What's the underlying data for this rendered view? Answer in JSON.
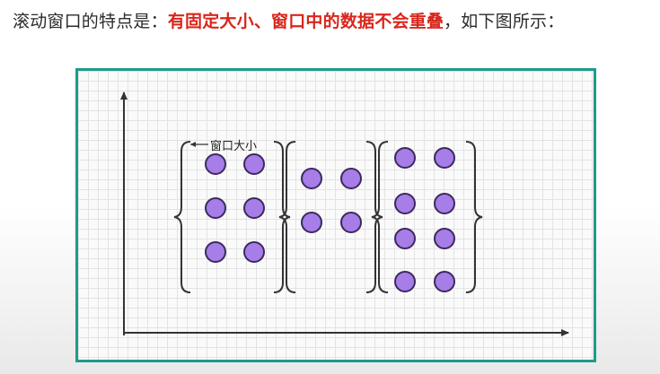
{
  "heading": {
    "prefix": "滚动窗口的特点是：",
    "emphasis": "有固定大小、窗口中的数据不会重叠",
    "suffix": "，如下图所示："
  },
  "diagram": {
    "window_label": "窗口大小",
    "windows": [
      {
        "dots": 6
      },
      {
        "dots": 4
      },
      {
        "dots": 8
      }
    ]
  },
  "colors": {
    "frame": "#1e9b8a",
    "dot_fill": "#a77de8",
    "dot_stroke": "#3b2a5e",
    "emphasis": "#d9261c"
  }
}
